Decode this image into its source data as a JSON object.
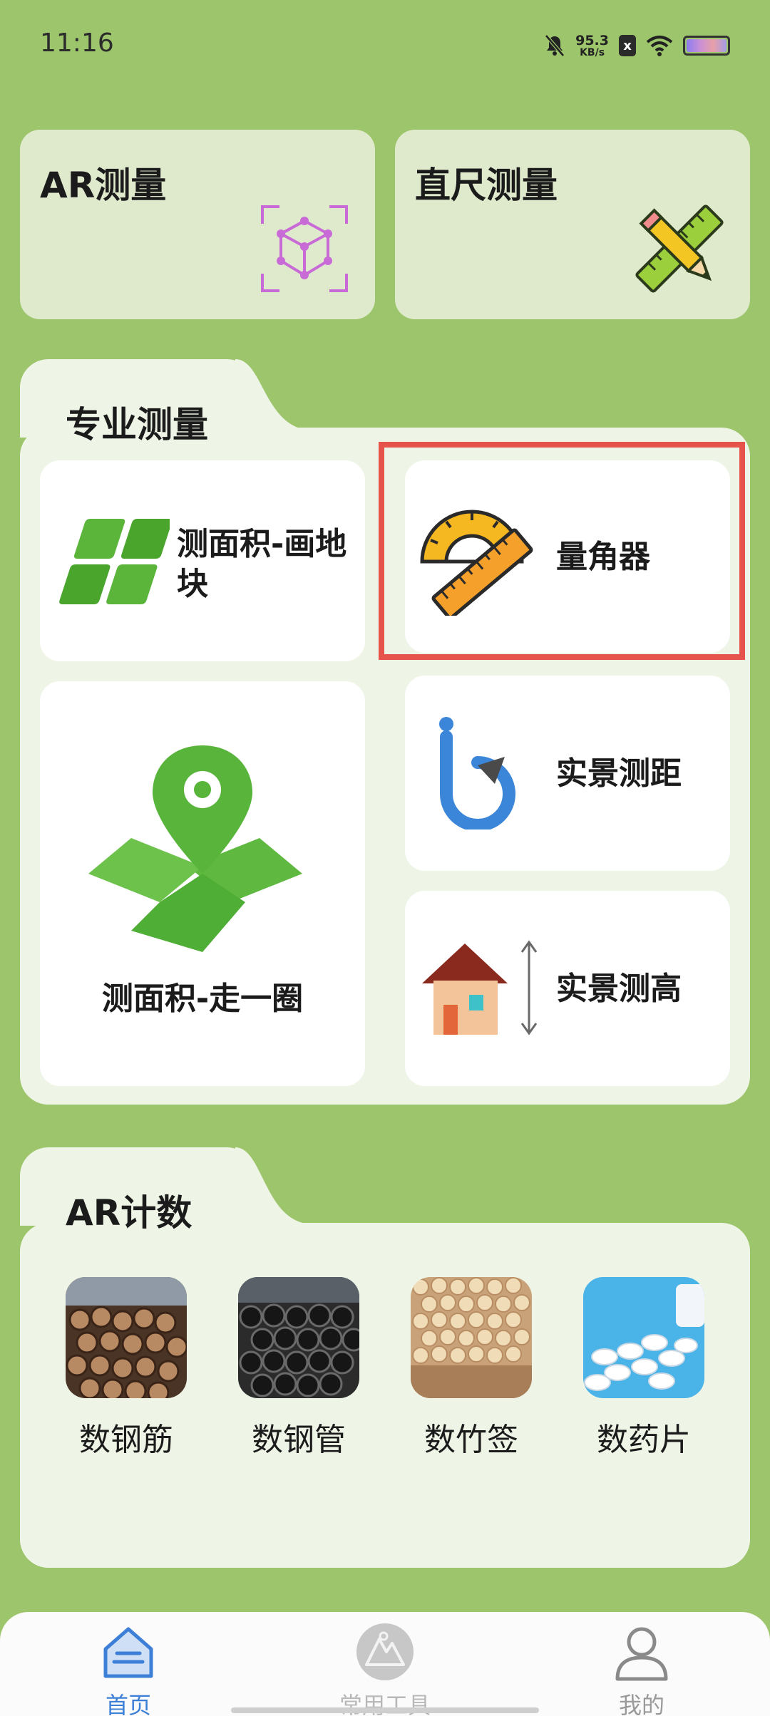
{
  "status": {
    "time": "11:16",
    "net_speed_value": "95.3",
    "net_speed_unit": "KB/s",
    "sim_badge": "x"
  },
  "top_cards": [
    {
      "title": "AR测量",
      "icon": "ar-cube-icon"
    },
    {
      "title": "直尺测量",
      "icon": "ruler-pencil-icon"
    }
  ],
  "pro": {
    "title": "专业测量",
    "tiles": [
      {
        "label": "测面积-画地块",
        "icon": "plot-area-icon"
      },
      {
        "label": "量角器",
        "icon": "protractor-icon"
      },
      {
        "label": "测面积-走一圈",
        "icon": "walk-area-icon"
      },
      {
        "label": "实景测距",
        "icon": "distance-icon"
      },
      {
        "label": "实景测高",
        "icon": "height-icon"
      }
    ]
  },
  "ar_count": {
    "title": "AR计数",
    "items": [
      {
        "label": "数钢筋",
        "icon": "rebar-photo"
      },
      {
        "label": "数钢管",
        "icon": "steel-pipe-photo"
      },
      {
        "label": "数竹签",
        "icon": "bamboo-stick-photo"
      },
      {
        "label": "数药片",
        "icon": "pill-photo"
      }
    ]
  },
  "nav": [
    {
      "label": "首页",
      "icon": "home-icon",
      "active": true
    },
    {
      "label": "常用工具",
      "icon": "tools-icon",
      "active": false
    },
    {
      "label": "我的",
      "icon": "profile-icon",
      "active": false
    }
  ],
  "colors": {
    "background": "#9dc56b",
    "highlight": "#e5534b",
    "nav_active": "#3d7fd6",
    "nav_inactive": "#9a9a9a"
  }
}
